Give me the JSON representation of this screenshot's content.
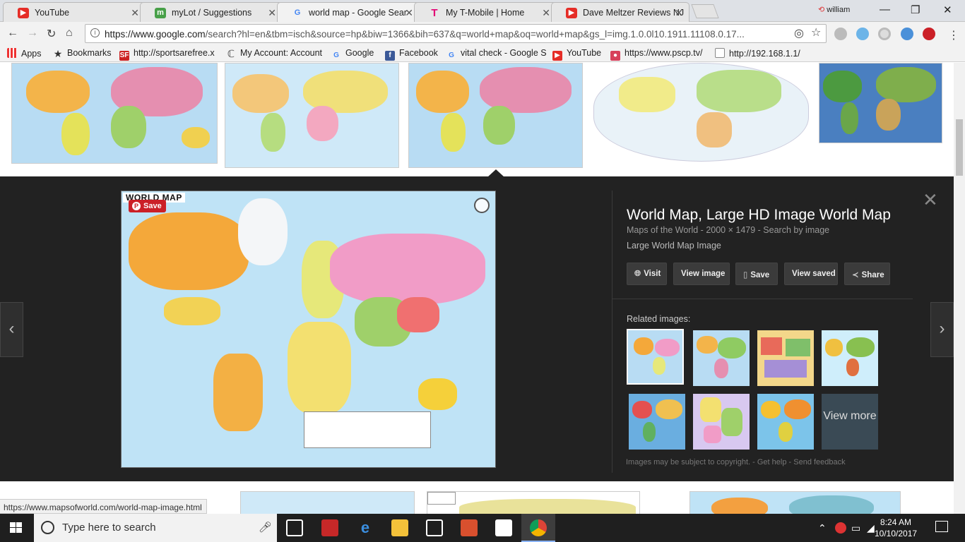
{
  "tabs": [
    {
      "title": "YouTube",
      "active": false
    },
    {
      "title": "myLot / Suggestions",
      "active": false
    },
    {
      "title": "world map - Google Sear",
      "active": true
    },
    {
      "title": "My T-Mobile | Home",
      "active": false
    },
    {
      "title": "Dave Meltzer Reviews NJ",
      "active": false
    }
  ],
  "user": "william",
  "address": {
    "domain": "https://www.google.com",
    "path": "/search?hl=en&tbm=isch&source=hp&biw=1366&bih=637&q=world+map&oq=world+map&gs_l=img.1.0.0l10.1911.11108.0.17..."
  },
  "bookmarks": [
    {
      "label": "Apps"
    },
    {
      "label": "Bookmarks"
    },
    {
      "label": "http://sportsarefree.x"
    },
    {
      "label": "My Account: Account"
    },
    {
      "label": "Google"
    },
    {
      "label": "Facebook"
    },
    {
      "label": "vital check - Google S"
    },
    {
      "label": "YouTube"
    },
    {
      "label": "https://www.pscp.tv/"
    },
    {
      "label": "http://192.168.1.1/"
    }
  ],
  "preview": {
    "image_title": "WORLD MAP",
    "save_label": "Save",
    "title": "World Map, Large HD Image World Map",
    "source": "Maps of the World",
    "size": "2000 × 1479",
    "search_by_image": "Search by image",
    "description": "Large World Map Image",
    "buttons": {
      "visit": "Visit",
      "view_image": "View image",
      "save": "Save",
      "view_saved": "View saved",
      "share": "Share"
    },
    "related_label": "Related images:",
    "view_more": "View more",
    "copyright": "Images may be subject to copyright.",
    "get_help": "Get help",
    "send_feedback": "Send feedback"
  },
  "status_url": "https://www.mapsofworld.com/world-map-image.html",
  "taskbar": {
    "search_placeholder": "Type here to search",
    "time": "8:24 AM",
    "date": "10/10/2017"
  }
}
